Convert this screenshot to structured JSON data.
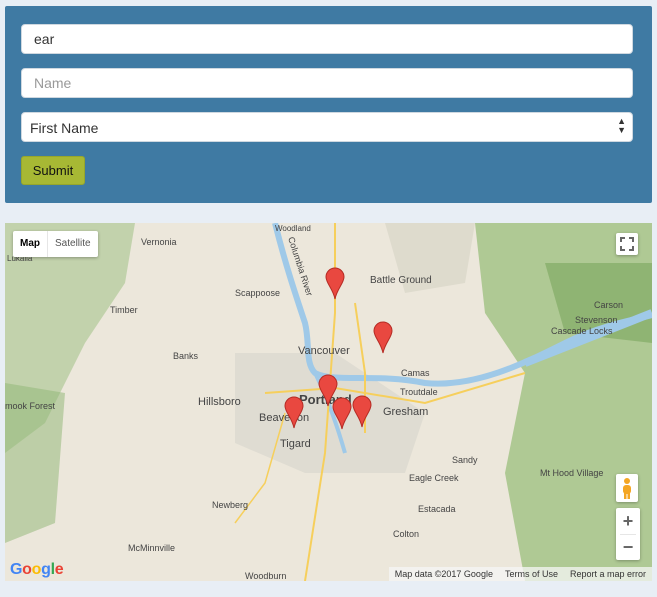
{
  "form": {
    "search": {
      "value": "ear",
      "placeholder": ""
    },
    "name": {
      "value": "",
      "placeholder": "Name"
    },
    "select": {
      "value": "First Name"
    },
    "submit_label": "Submit"
  },
  "map": {
    "type_controls": [
      "Map",
      "Satellite"
    ],
    "places": [
      "Vernonia",
      "Scappoose",
      "Battle Ground",
      "Timber",
      "Banks",
      "Vancouver",
      "Camas",
      "Hillsboro",
      "Portland",
      "Beaverton",
      "Gresham",
      "Troutdale",
      "Tigard",
      "Sandy",
      "Eagle Creek",
      "Newberg",
      "McMinnville",
      "Estacada",
      "Colton",
      "Woodburn",
      "Carson",
      "Stevenson",
      "Cascade Locks",
      "Mt Hood Village",
      "Columbia River",
      "Lukalla",
      "mook Forest",
      "Woodland"
    ],
    "footer": [
      "Map data ©2017 Google",
      "Terms of Use",
      "Report a map error"
    ],
    "logo": "Google",
    "zoom_in": "+",
    "zoom_out": "−",
    "colors": {
      "marker": "#e94840",
      "water": "#9fc9e8",
      "terrain": "#7fae5f"
    }
  }
}
